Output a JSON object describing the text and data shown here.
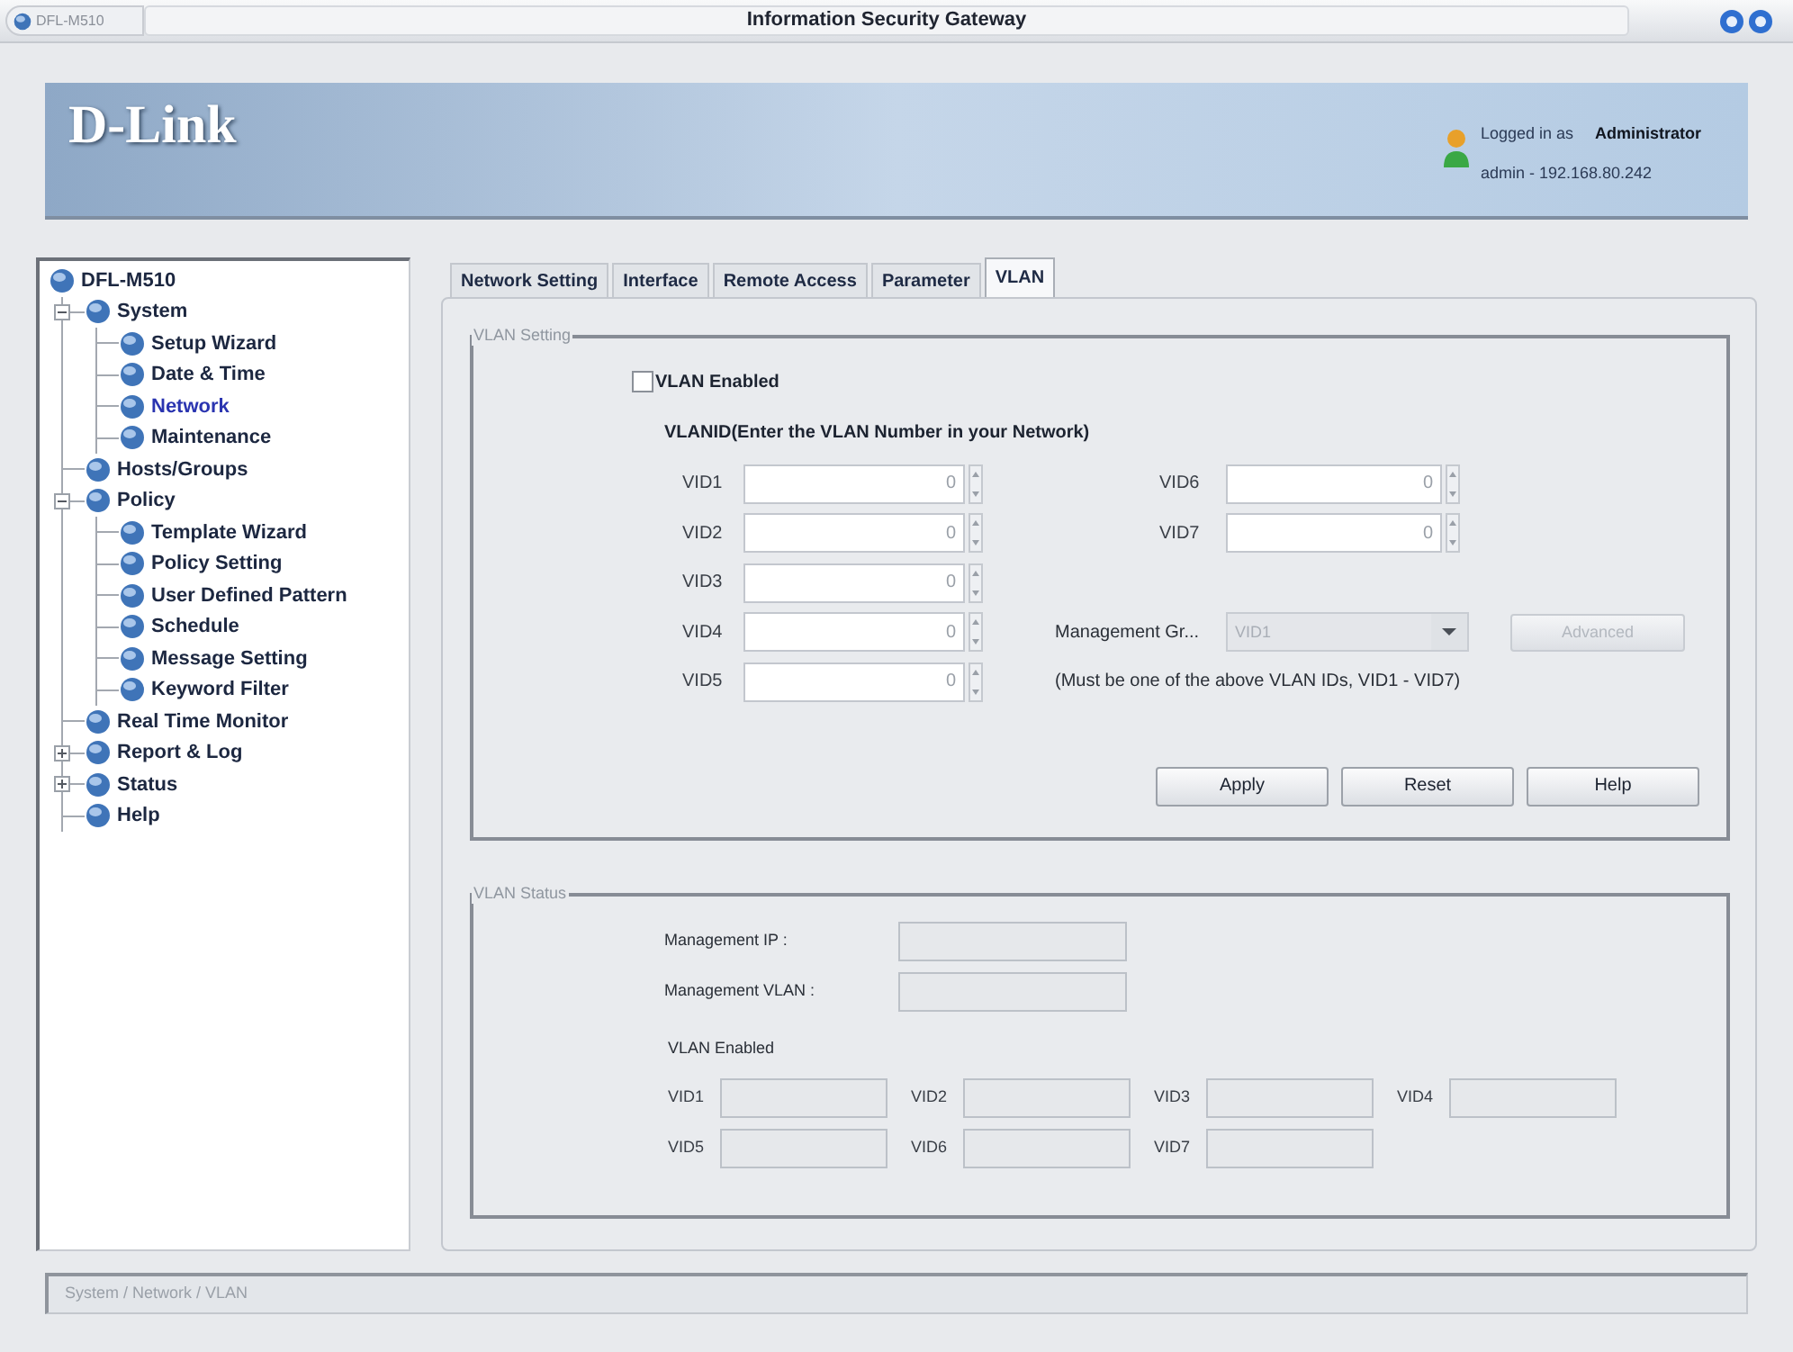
{
  "window": {
    "app_label": "DFL-M510",
    "title": "Information Security Gateway"
  },
  "header": {
    "logo": "D-Link",
    "login_label": "Logged in as",
    "user": "Administrator",
    "session": "admin - 192.168.80.242"
  },
  "tree": [
    {
      "label": "DFL-M510",
      "selected": false,
      "children": [
        {
          "label": "System",
          "selected": false,
          "expanded": true,
          "children": [
            {
              "label": "Setup Wizard",
              "selected": false
            },
            {
              "label": "Date & Time",
              "selected": false
            },
            {
              "label": "Network",
              "selected": true
            },
            {
              "label": "Maintenance",
              "selected": false
            }
          ]
        },
        {
          "label": "Hosts/Groups",
          "selected": false
        },
        {
          "label": "Policy",
          "selected": false,
          "expanded": true,
          "children": [
            {
              "label": "Template Wizard",
              "selected": false
            },
            {
              "label": "Policy Setting",
              "selected": false
            },
            {
              "label": "User Defined Pattern",
              "selected": false
            },
            {
              "label": "Schedule",
              "selected": false
            },
            {
              "label": "Message Setting",
              "selected": false
            },
            {
              "label": "Keyword Filter",
              "selected": false
            }
          ]
        },
        {
          "label": "Real Time Monitor",
          "selected": false
        },
        {
          "label": "Report & Log",
          "selected": false,
          "expanded": false
        },
        {
          "label": "Status",
          "selected": false,
          "expanded": false
        },
        {
          "label": "Help",
          "selected": false
        }
      ]
    }
  ],
  "tabs": [
    {
      "label": "Network Setting",
      "selected": false
    },
    {
      "label": "Interface",
      "selected": false
    },
    {
      "label": "Remote Access",
      "selected": false
    },
    {
      "label": "Parameter",
      "selected": false
    },
    {
      "label": "VLAN",
      "selected": true
    }
  ],
  "vlan_setting": {
    "title": "VLAN Setting",
    "enable": {
      "label": "VLAN Enabled",
      "checked": false
    },
    "heading": "VLANID(Enter the VLAN Number in your Network)",
    "vids": [
      {
        "label": "VID1",
        "value": "0"
      },
      {
        "label": "VID2",
        "value": "0"
      },
      {
        "label": "VID3",
        "value": "0"
      },
      {
        "label": "VID4",
        "value": "0"
      },
      {
        "label": "VID5",
        "value": "0"
      },
      {
        "label": "VID6",
        "value": "0"
      },
      {
        "label": "VID7",
        "value": "0"
      }
    ],
    "management_group": {
      "label": "Management Gr...",
      "value": "VID1",
      "disabled": true
    },
    "advanced_button": {
      "label": "Advanced",
      "disabled": true
    },
    "note": "(Must be one of the above VLAN IDs, VID1 - VID7)",
    "buttons": [
      "Apply",
      "Reset",
      "Help"
    ]
  },
  "vlan_status": {
    "title": "VLAN Status",
    "fields": [
      "Management IP :",
      "Management VLAN :"
    ],
    "enabled_label": "VLAN Enabled",
    "vids": [
      "VID1",
      "VID2",
      "VID3",
      "VID4",
      "VID5",
      "VID6",
      "VID7"
    ]
  },
  "status_bar": {
    "path": "System / Network / VLAN"
  }
}
